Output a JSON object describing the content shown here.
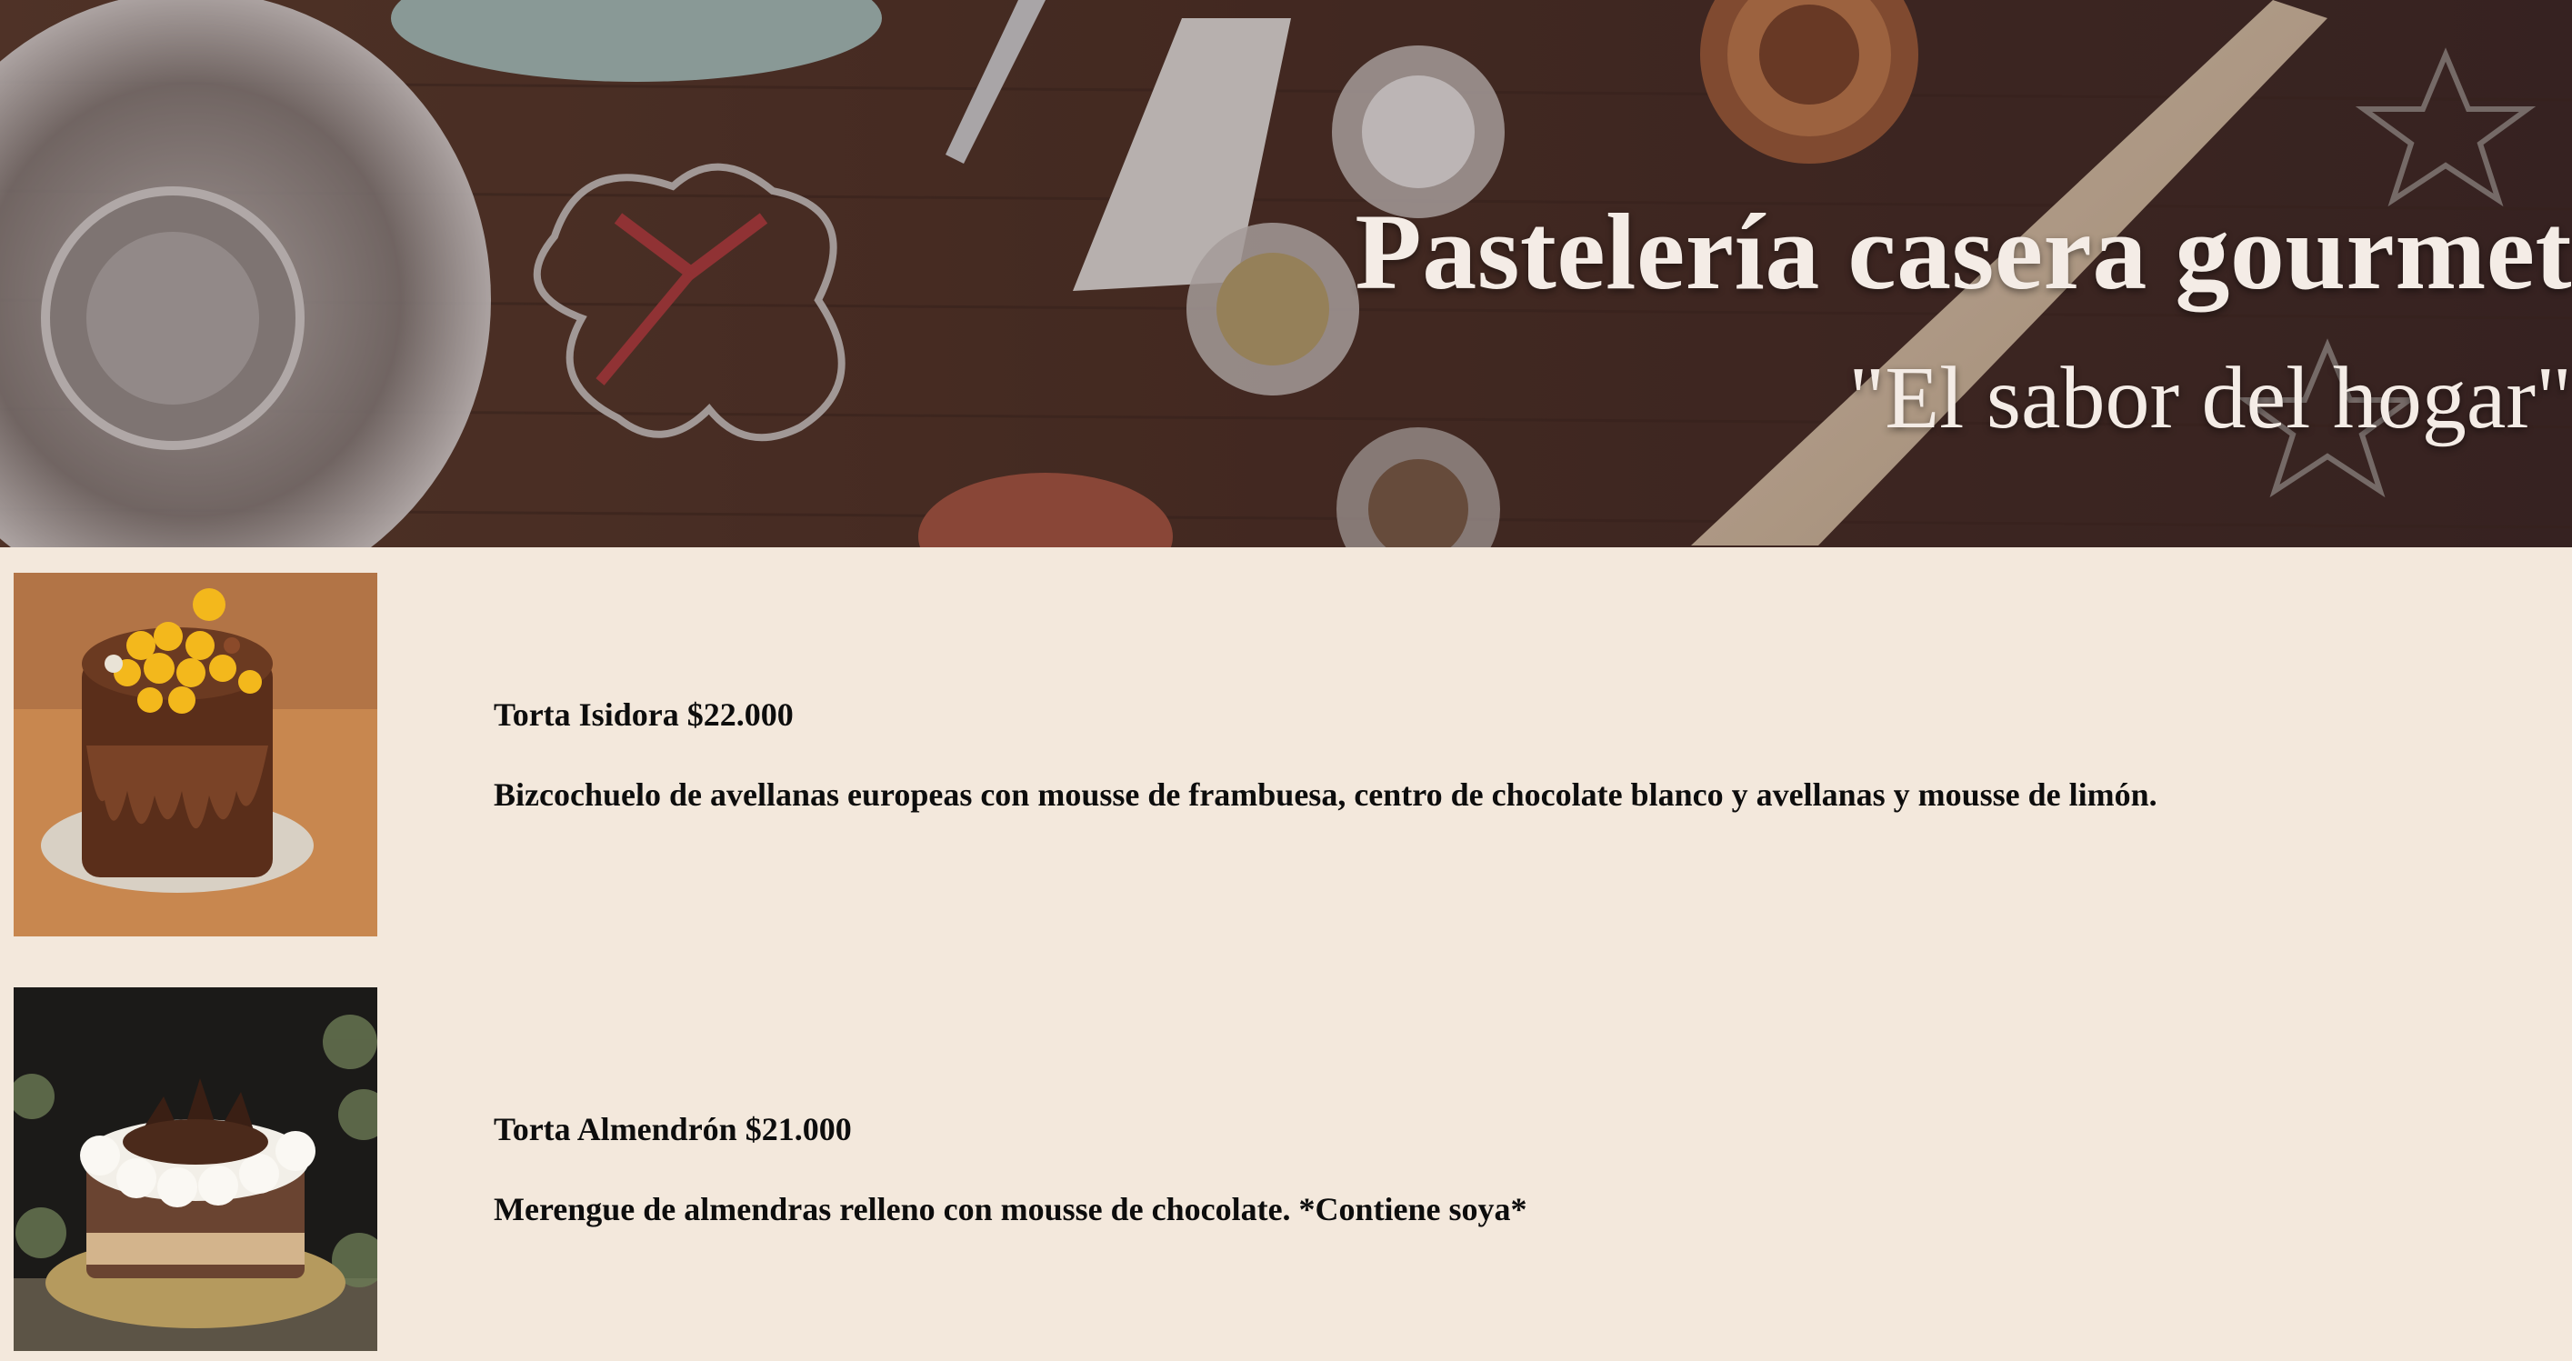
{
  "hero": {
    "title": "Pastelería casera gourmet",
    "subtitle": "\"El sabor del hogar\""
  },
  "products": [
    {
      "title": "Torta Isidora $22.000",
      "description": "Bizcochuelo de avellanas europeas con mousse de frambuesa, centro de chocolate blanco y avellanas y mousse de limón.",
      "image": "chocolate-drip-cake-image"
    },
    {
      "title": "Torta Almendrón $21.000",
      "description": "Merengue de almendras relleno con mousse de chocolate. *Contiene soya*",
      "image": "meringue-chocolate-cake-image"
    }
  ],
  "colors": {
    "page_background": "#f3e8dc",
    "hero_wood": "#4a2e22",
    "hero_text": "#f4ece6",
    "body_text": "#0d0d0d"
  }
}
